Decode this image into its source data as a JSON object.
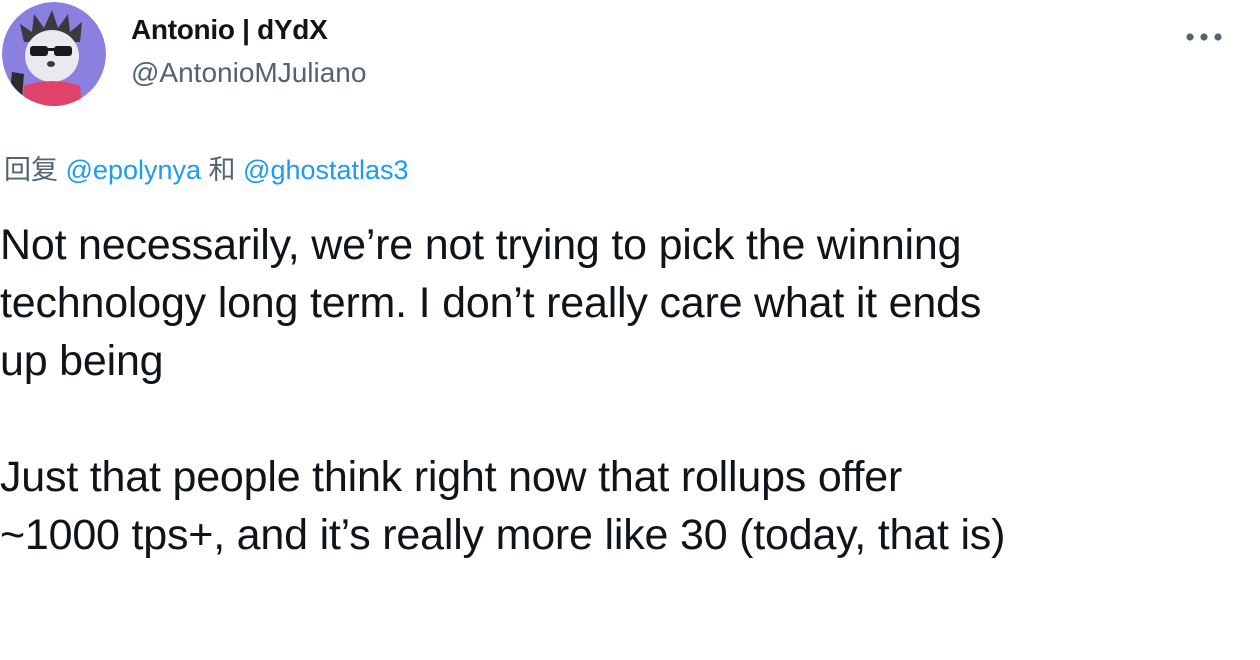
{
  "author": {
    "display_name": "Antonio | dYdX",
    "handle": "@AntonioMJuliano",
    "avatar_icon": "hedgehog-avatar-icon"
  },
  "menu": {
    "icon": "more-horizontal-icon"
  },
  "reply": {
    "prefix": "回复",
    "mention_1": "@epolynya",
    "joiner": "和",
    "mention_2": "@ghostatlas3"
  },
  "tweet": {
    "line_1": "Not necessarily, we’re not trying to pick the winning",
    "line_2": "technology long term. I don’t really care what it ends",
    "line_3": "up being",
    "line_4": "Just that people think right now that rollups offer",
    "line_5": "~1000 tps+, and it’s really more like 30 (today, that is)"
  },
  "colors": {
    "text": "#0f1419",
    "secondary": "#536471",
    "link": "#1d9bf0",
    "avatar_bg": "#8b7fe0"
  }
}
